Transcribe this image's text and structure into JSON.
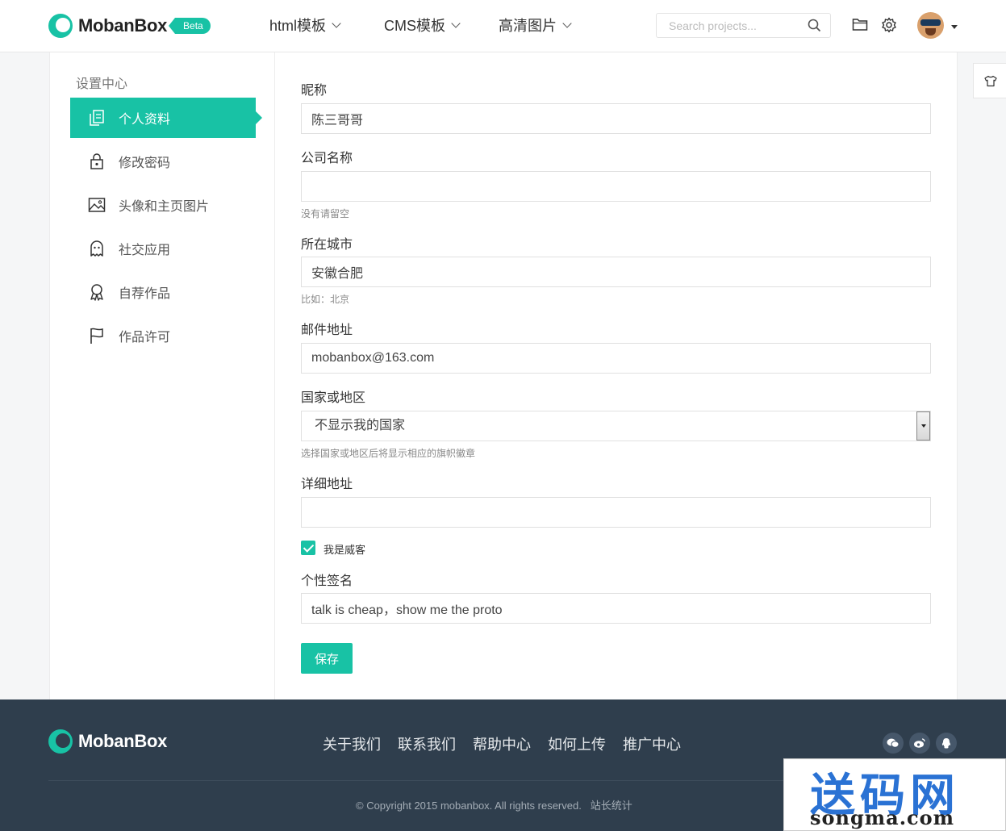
{
  "header": {
    "logo_text": "MobanBox",
    "badge": "Beta",
    "nav": [
      {
        "label": "html模板"
      },
      {
        "label": "CMS模板"
      },
      {
        "label": "高清图片"
      }
    ],
    "search_placeholder": "Search projects...",
    "icons": [
      "folder-icon",
      "gear-icon"
    ]
  },
  "sidebar": {
    "title": "设置中心",
    "items": [
      {
        "label": "个人资料",
        "icon": "document-icon",
        "active": true
      },
      {
        "label": "修改密码",
        "icon": "lock-icon"
      },
      {
        "label": "头像和主页图片",
        "icon": "image-icon"
      },
      {
        "label": "社交应用",
        "icon": "ghost-icon"
      },
      {
        "label": "自荐作品",
        "icon": "award-icon"
      },
      {
        "label": "作品许可",
        "icon": "flag-icon"
      }
    ]
  },
  "form": {
    "nickname": {
      "label": "昵称",
      "value": "陈三哥哥"
    },
    "company": {
      "label": "公司名称",
      "value": "",
      "help": "没有请留空"
    },
    "city": {
      "label": "所在城市",
      "value": "安徽合肥",
      "help": "比如：北京"
    },
    "email": {
      "label": "邮件地址",
      "value": "mobanbox@163.com"
    },
    "country": {
      "label": "国家或地区",
      "value": "不显示我的国家",
      "help": "选择国家或地区后将显示相应的旗帜徽章"
    },
    "address": {
      "label": "详细地址",
      "value": ""
    },
    "weike": {
      "label": "我是威客",
      "checked": true
    },
    "signature": {
      "label": "个性签名",
      "value": "talk is cheap，show me the proto"
    },
    "save_label": "保存"
  },
  "footer": {
    "logo_text": "MobanBox",
    "links": [
      "关于我们",
      "联系我们",
      "帮助中心",
      "如何上传",
      "推广中心"
    ],
    "social": [
      "wechat-icon",
      "weibo-icon",
      "qq-icon"
    ],
    "copyright": "© Copyright 2015 mobanbox. All rights reserved.",
    "stats_link": "站长统计"
  },
  "watermark": {
    "big": "送码网",
    "small": "songma.com"
  },
  "colors": {
    "accent": "#18c2a5",
    "footer_bg": "#2f3e4d"
  }
}
